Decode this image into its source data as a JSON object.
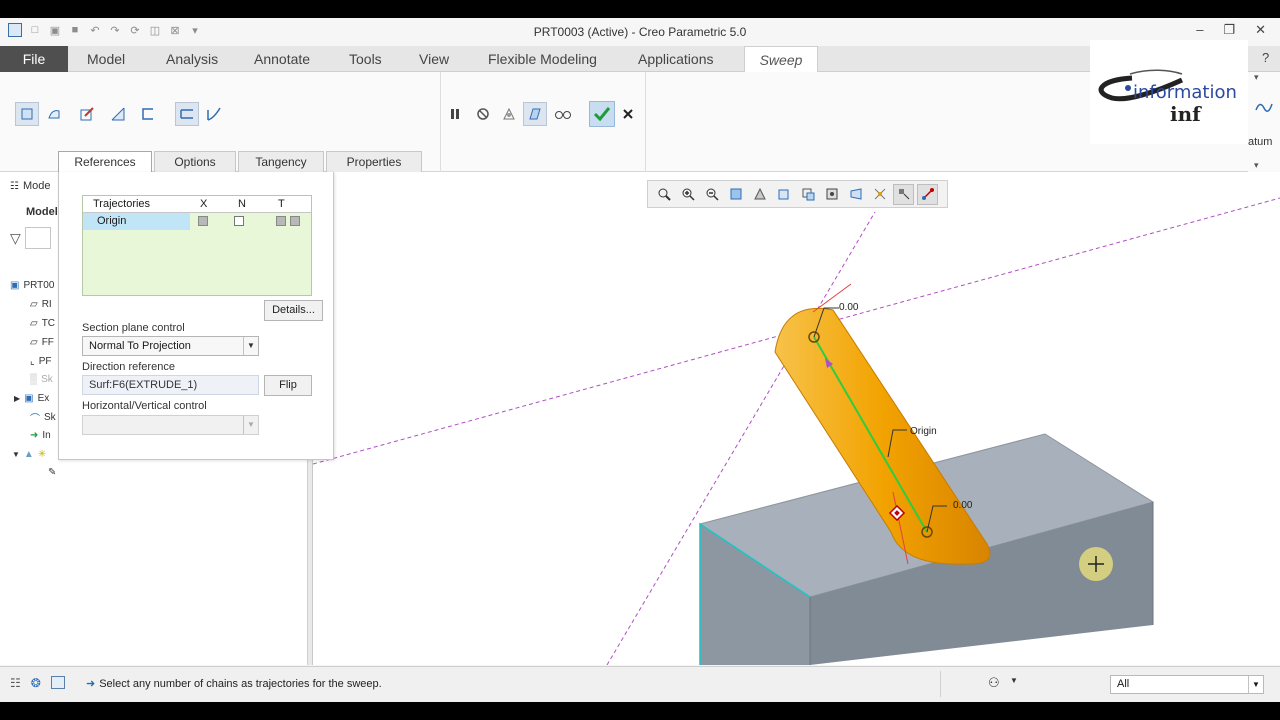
{
  "window": {
    "title": "PRT0003 (Active) - Creo Parametric 5.0"
  },
  "menu": {
    "file": "File",
    "model": "Model",
    "analysis": "Analysis",
    "annotate": "Annotate",
    "tools": "Tools",
    "view": "View",
    "flexible_modeling": "Flexible Modeling",
    "applications": "Applications",
    "sweep": "Sweep"
  },
  "ribbon": {
    "right_partial_label": "atum"
  },
  "logo": {
    "line1": "information",
    "line2": "inf"
  },
  "dashboard_tabs": {
    "references": "References",
    "options": "Options",
    "tangency": "Tangency",
    "properties": "Properties"
  },
  "references_panel": {
    "table_headers": {
      "name": "Trajectories",
      "x": "X",
      "n": "N",
      "t": "T"
    },
    "rows": [
      {
        "name": "Origin"
      }
    ],
    "details_button": "Details...",
    "section_plane_control_label": "Section plane control",
    "section_plane_control_value": "Normal To Projection",
    "direction_reference_label": "Direction reference",
    "direction_reference_value": "Surf:F6(EXTRUDE_1)",
    "flip_button": "Flip",
    "hv_control_label": "Horizontal/Vertical control"
  },
  "model_tree": {
    "header": "Mode",
    "title": "Model",
    "root": "PRT00",
    "items": [
      "RI",
      "TC",
      "FF",
      "PF",
      "Sk",
      "Ex",
      "Sk",
      "In"
    ]
  },
  "graphics": {
    "dim_top": "0.00",
    "dim_bottom": "0.00",
    "origin_label": "Origin"
  },
  "status": {
    "message": "Select any number of chains as trajectories for the sweep.",
    "filter": "All"
  },
  "colors": {
    "sweep_body": "#f2a300",
    "block": "#a7b0ba",
    "trajectory": "#2ecc40",
    "datum_line": "#b04fc4",
    "accent_tab": "#4f4f4f"
  }
}
